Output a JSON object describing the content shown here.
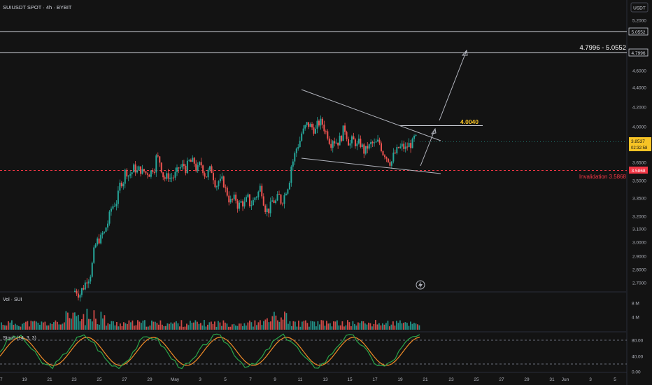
{
  "header": {
    "symbol_line": "SUIUSDT SPOT · 4h · BYBIT",
    "currency": "USDT"
  },
  "colors": {
    "background": "#131313",
    "up": "#26a69a",
    "down": "#ef5350",
    "yellow": "#f7c325",
    "invalidation": "#f23645",
    "stoch_k": "#2aa54a",
    "stoch_d": "#f28c28",
    "line": "#d1d4dc"
  },
  "price_axis": {
    "ticks": [
      "5.2000",
      "5.0000",
      "4.8000",
      "4.6000",
      "4.4000",
      "4.2000",
      "4.0000",
      "3.6500",
      "3.5000",
      "3.3500",
      "3.2000",
      "3.1000",
      "3.0000",
      "2.9000",
      "2.8000",
      "2.7000"
    ],
    "current_price": "3.8537",
    "countdown": "02:32:58",
    "level_tags": [
      "5.0552",
      "4.7996",
      "3.5868"
    ]
  },
  "annotations": {
    "target_range": "4.7996 - 5.0552",
    "breakout_level": "4.0040",
    "invalidation": "Invalidation 3.5868"
  },
  "volume_pane": {
    "title": "Vol · SUI",
    "ticks": [
      "8 M",
      "4 M"
    ]
  },
  "stoch_pane": {
    "title": "Stoch (14, 3, 3)",
    "ticks": [
      "80.00",
      "40.00",
      "0.00"
    ]
  },
  "time_axis": {
    "labels": [
      "7",
      "19",
      "21",
      "23",
      "25",
      "27",
      "29",
      "May",
      "3",
      "5",
      "7",
      "9",
      "11",
      "13",
      "15",
      "17",
      "19",
      "21",
      "23",
      "25",
      "27",
      "29",
      "31",
      "Jun",
      "3",
      "5"
    ]
  },
  "chart_data": {
    "type": "candlestick",
    "interval": "4h",
    "price_scale": "log",
    "price_axis_visible_range": [
      2.66,
      5.3
    ],
    "x": [
      "Apr 18",
      "Apr 19",
      "Apr 20",
      "Apr 21",
      "Apr 22",
      "Apr 23",
      "Apr 24",
      "Apr 25",
      "Apr 26",
      "Apr 27",
      "Apr 28",
      "Apr 29",
      "Apr 30",
      "May 1",
      "May 2",
      "May 3",
      "May 4",
      "May 5",
      "May 6",
      "May 7",
      "May 8",
      "May 9",
      "May 10",
      "May 11",
      "May 12",
      "May 13",
      "May 14",
      "May 15",
      "May 16",
      "May 17",
      "May 18",
      "May 19",
      "May 20"
    ],
    "close": [
      2.68,
      2.9,
      3.05,
      3.3,
      3.55,
      3.6,
      3.55,
      3.68,
      3.5,
      3.54,
      3.6,
      3.57,
      3.55,
      3.48,
      3.34,
      3.27,
      3.3,
      3.42,
      3.25,
      3.32,
      3.62,
      3.92,
      3.98,
      4.02,
      3.88,
      3.93,
      3.84,
      3.76,
      3.8,
      3.74,
      3.73,
      3.76,
      3.85
    ],
    "levels": [
      {
        "label": "5.0552",
        "value": 5.0552
      },
      {
        "label": "4.7996",
        "value": 4.7996
      },
      {
        "label": "4.0040",
        "value": 4.004
      },
      {
        "label": "Invalidation 3.5868",
        "value": 3.5868
      }
    ],
    "volume_axis_ticks": [
      "8 M",
      "4 M"
    ],
    "stoch_levels": [
      80,
      40,
      0
    ]
  }
}
